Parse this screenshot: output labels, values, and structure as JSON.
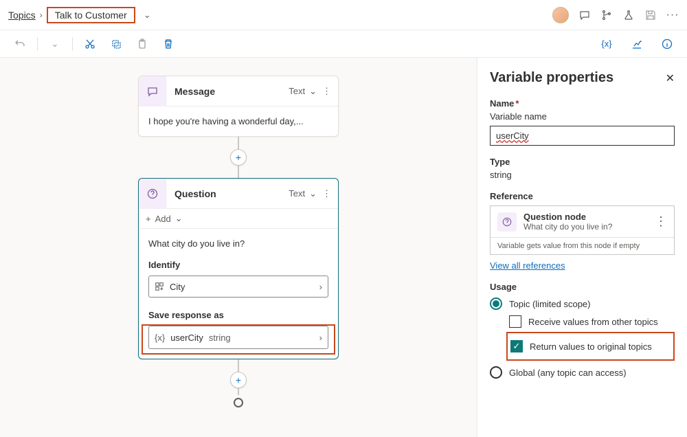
{
  "breadcrumb": {
    "root": "Topics",
    "current": "Talk to Customer"
  },
  "nodes": {
    "message": {
      "title": "Message",
      "format": "Text",
      "body": "I hope you're having a wonderful day,..."
    },
    "question": {
      "title": "Question",
      "format": "Text",
      "add": "Add",
      "prompt": "What city do you live in?",
      "identify_label": "Identify",
      "identify_value": "City",
      "save_label": "Save response as",
      "var_name": "userCity",
      "var_type": "string"
    }
  },
  "panel": {
    "title": "Variable properties",
    "name_label": "Name",
    "name_sub": "Variable name",
    "name_value": "userCity",
    "type_label": "Type",
    "type_value": "string",
    "reference_label": "Reference",
    "reference": {
      "title": "Question node",
      "sub": "What city do you live in?",
      "meta": "Variable gets value from this node if empty"
    },
    "view_all": "View all references",
    "usage_label": "Usage",
    "usage": {
      "topic": "Topic (limited scope)",
      "receive": "Receive values from other topics",
      "return": "Return values to original topics",
      "global": "Global (any topic can access)"
    }
  }
}
